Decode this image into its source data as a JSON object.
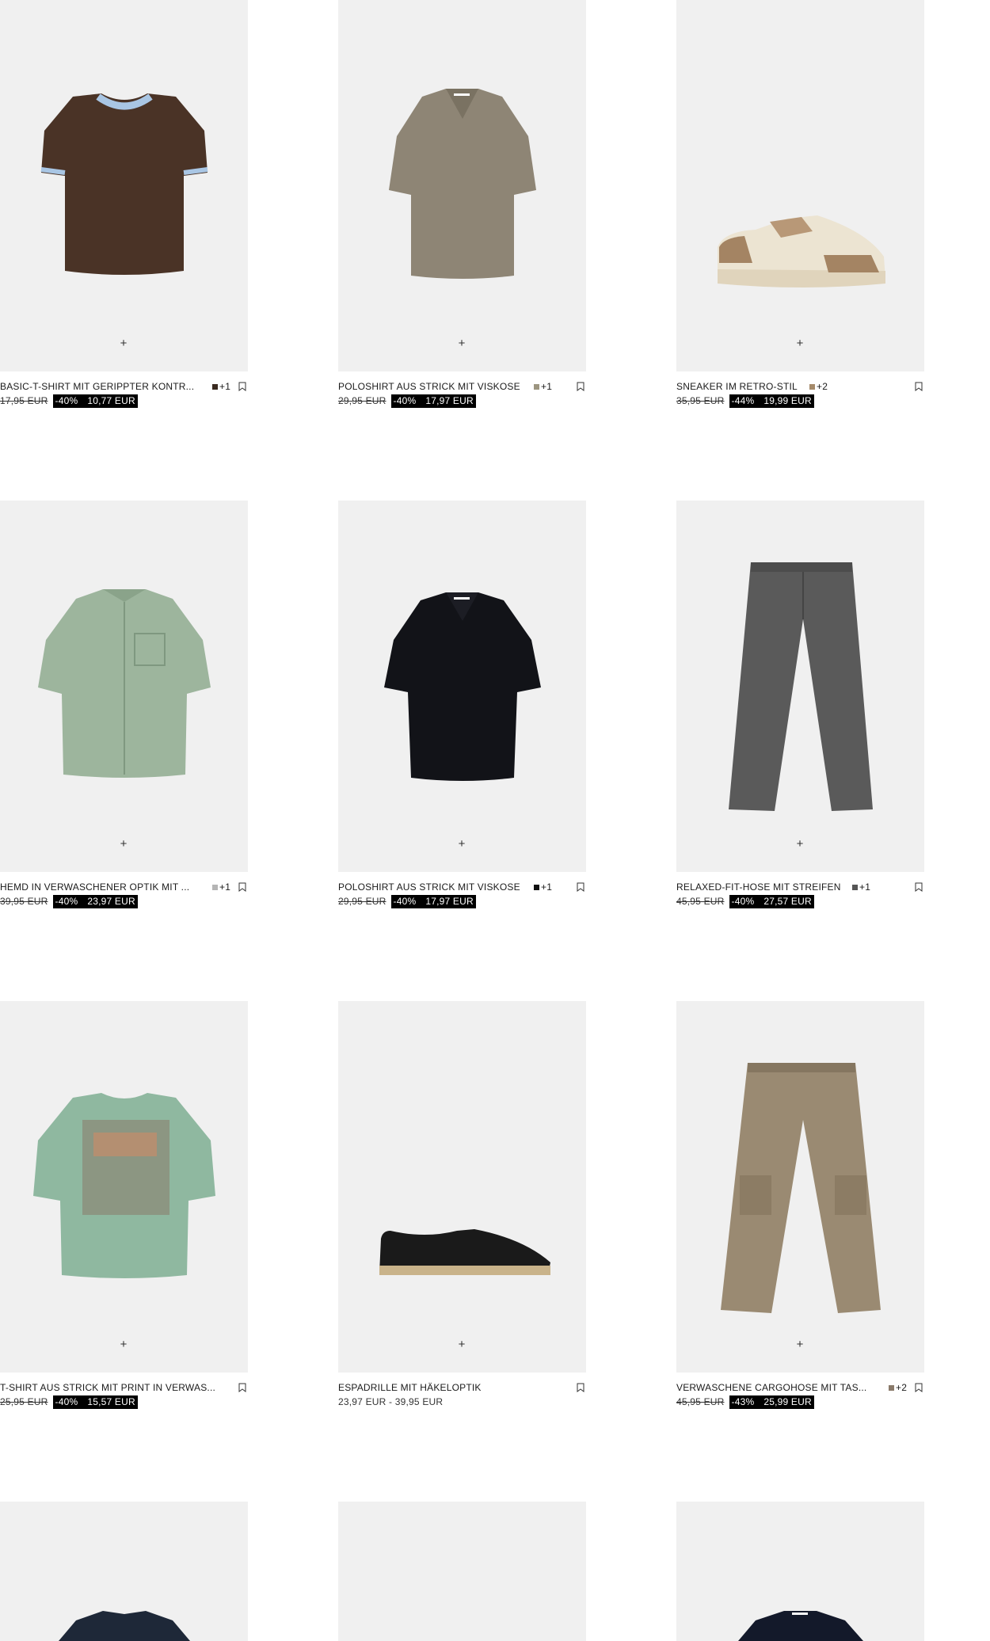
{
  "products": [
    {
      "name": "BASIC-T-SHIRT MIT GERIPPTER KONTR...",
      "swatch_color": "#3a2a20",
      "more_colors": "+1",
      "old_price": "17,95 EUR",
      "discount": "-40%",
      "price": "10,77 EUR",
      "image": "brown-tshirt-blue-trim"
    },
    {
      "name": "POLOSHIRT AUS STRICK MIT VISKOSE",
      "swatch_color": "#9c9580",
      "more_colors": "+1",
      "old_price": "29,95 EUR",
      "discount": "-40%",
      "price": "17,97 EUR",
      "image": "taupe-knit-polo"
    },
    {
      "name": "SNEAKER IM RETRO-STIL",
      "swatch_color": "#a58a6a",
      "more_colors": "+2",
      "old_price": "35,95 EUR",
      "discount": "-44%",
      "price": "19,99 EUR",
      "image": "retro-sneaker"
    },
    {
      "name": "HEMD IN VERWASCHENER OPTIK MIT ...",
      "swatch_color": "#b5b5b5",
      "more_colors": "+1",
      "old_price": "39,95 EUR",
      "discount": "-40%",
      "price": "23,97 EUR",
      "image": "washed-green-shirt"
    },
    {
      "name": "POLOSHIRT AUS STRICK MIT VISKOSE",
      "swatch_color": "#111111",
      "more_colors": "+1",
      "old_price": "29,95 EUR",
      "discount": "-40%",
      "price": "17,97 EUR",
      "image": "black-knit-polo"
    },
    {
      "name": "RELAXED-FIT-HOSE MIT STREIFEN",
      "swatch_color": "#555555",
      "more_colors": "+1",
      "old_price": "45,95 EUR",
      "discount": "-40%",
      "price": "27,57 EUR",
      "image": "grey-trousers"
    },
    {
      "name": "T-SHIRT AUS STRICK MIT PRINT IN VERWAS...",
      "swatch_color": "",
      "more_colors": "",
      "old_price": "25,95 EUR",
      "discount": "-40%",
      "price": "15,57 EUR",
      "image": "green-print-tshirt"
    },
    {
      "name": "ESPADRILLE MIT HÄKELOPTIK",
      "swatch_color": "",
      "more_colors": "",
      "price_range": "23,97 EUR - 39,95 EUR",
      "image": "black-espadrille"
    },
    {
      "name": "VERWASCHENE CARGOHOSE MIT TAS...",
      "swatch_color": "#8a7a6a",
      "more_colors": "+2",
      "old_price": "45,95 EUR",
      "discount": "-43%",
      "price": "25,99 EUR",
      "image": "washed-cargo-pants"
    },
    {
      "image": "navy-shirt"
    },
    {
      "image": "empty"
    },
    {
      "image": "navy-zip-polo"
    }
  ],
  "add_label": "+",
  "colors": {
    "background": "#ffffff",
    "image_bg": "#f0f0f0",
    "promo_bg": "#000000",
    "promo_text": "#ffffff",
    "text": "#1a1a1a"
  }
}
